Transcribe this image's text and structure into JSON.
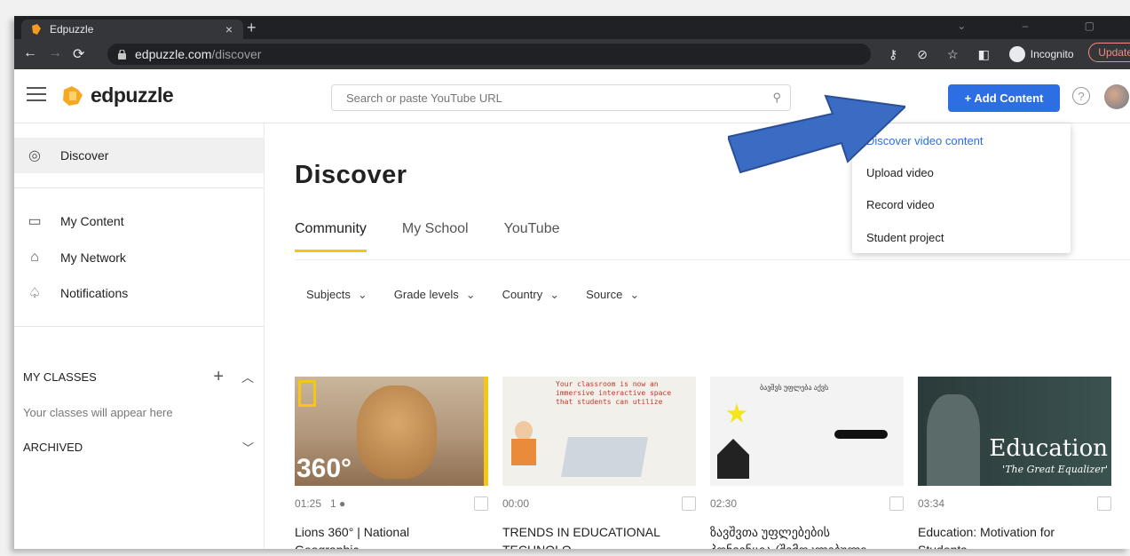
{
  "browser": {
    "tab_title": "Edpuzzle",
    "tab_close": "×",
    "new_tab": "+",
    "url_host": "edpuzzle.com",
    "url_path": "/discover",
    "incognito_label": "Incognito",
    "update_label": "Update"
  },
  "app": {
    "logo_text": "edpuzzle",
    "search_placeholder": "Search or paste YouTube URL",
    "add_content_label": "+ Add Content",
    "help_label": "?"
  },
  "sidebar": {
    "items": [
      {
        "label": "Discover",
        "icon": "compass-icon"
      },
      {
        "label": "My Content",
        "icon": "folder-icon"
      },
      {
        "label": "My Network",
        "icon": "network-icon"
      },
      {
        "label": "Notifications",
        "icon": "bell-icon"
      }
    ],
    "my_classes": "MY CLASSES",
    "classes_empty": "Your classes will appear here",
    "archived": "ARCHIVED"
  },
  "main": {
    "title": "Discover",
    "tabs": [
      "Community",
      "My School",
      "YouTube"
    ],
    "filters": [
      "Subjects",
      "Grade levels",
      "Country",
      "Source"
    ],
    "cards": [
      {
        "duration": "01:25",
        "extra": "1 ●",
        "title": "Lions 360° | National",
        "title2": "Geographic",
        "thumb_text": "360°"
      },
      {
        "duration": "00:00",
        "extra": "",
        "title": "TRENDS IN EDUCATIONAL",
        "title2": "TECHNOLO...",
        "thumb_text": "Your classroom is now an immersive interactive space that students can utilize"
      },
      {
        "duration": "02:30",
        "extra": "",
        "title": "ზავშვთა უფლებების",
        "title2": "პონვენცია (შემოკლებული",
        "thumb_text": "ბავშვს უფლება აქვს"
      },
      {
        "duration": "03:34",
        "extra": "",
        "title": "Education: Motivation for",
        "title2": "Students",
        "thumb_text": "Education",
        "thumb_sub": "'The Great Equalizer'"
      }
    ]
  },
  "dropdown": {
    "items": [
      "Discover video content",
      "Upload video",
      "Record video",
      "Student project"
    ]
  },
  "colors": {
    "accent": "#2d6fe3",
    "tab_underline": "#f5c518",
    "arrow": "#3b6cc4"
  }
}
